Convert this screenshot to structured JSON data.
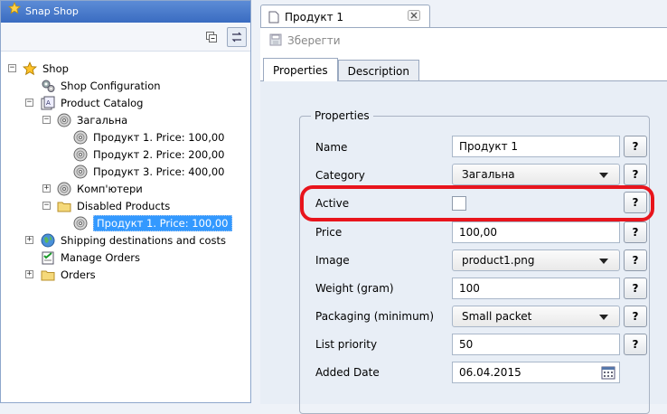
{
  "app": {
    "title": "Snap Shop"
  },
  "tree": {
    "nodes": [
      {
        "label": "Shop",
        "icon": "star-icon"
      },
      {
        "label": "Shop Configuration",
        "icon": "gears-icon"
      },
      {
        "label": "Product Catalog",
        "icon": "catalog-icon"
      },
      {
        "label": "Загальна",
        "icon": "disc-icon"
      },
      {
        "label": "Продукт 1. Price: 100,00",
        "icon": "disc-icon"
      },
      {
        "label": "Продукт 2. Price: 200,00",
        "icon": "disc-icon"
      },
      {
        "label": "Продукт 3. Price: 400,00",
        "icon": "disc-icon"
      },
      {
        "label": "Комп'ютери",
        "icon": "disc-icon"
      },
      {
        "label": "Disabled Products",
        "icon": "folder-icon"
      },
      {
        "label": "Продукт 1. Price: 100,00",
        "icon": "disc-icon",
        "selected": true
      },
      {
        "label": "Shipping destinations and costs",
        "icon": "globe-icon"
      },
      {
        "label": "Manage Orders",
        "icon": "check-list-icon"
      },
      {
        "label": "Orders",
        "icon": "folder-icon"
      }
    ]
  },
  "editor": {
    "tab_title": "Продукт 1",
    "save_label": "Зберегти",
    "tabs": [
      "Properties",
      "Description"
    ],
    "active_tab": "Properties",
    "group_title": "Properties",
    "help_label": "?",
    "fields": {
      "name": {
        "label": "Name",
        "value": "Продукт 1"
      },
      "category": {
        "label": "Category",
        "value": "Загальна"
      },
      "active": {
        "label": "Active",
        "checked": false
      },
      "price": {
        "label": "Price",
        "value": "100,00"
      },
      "image": {
        "label": "Image",
        "value": "product1.png"
      },
      "weight": {
        "label": "Weight (gram)",
        "value": "100"
      },
      "packaging": {
        "label": "Packaging (minimum)",
        "value": "Small packet"
      },
      "priority": {
        "label": "List priority",
        "value": "50"
      },
      "date": {
        "label": "Added Date",
        "value": "06.04.2015"
      }
    }
  },
  "colors": {
    "highlight": "#e8141c",
    "selection": "#3399ff",
    "title_bar": "#3a6cc1"
  }
}
